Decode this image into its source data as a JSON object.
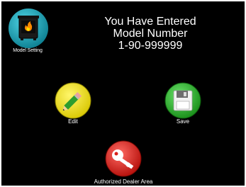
{
  "model_setting": {
    "label": "Model Setting",
    "icon": "stove-fire-icon"
  },
  "message": {
    "line1": "You Have Entered",
    "line2": "Model Number",
    "line3": "1-90-999999"
  },
  "buttons": {
    "edit": {
      "label": "Edit",
      "icon": "pencil-icon",
      "color": "#f4e400"
    },
    "save": {
      "label": "Save",
      "icon": "floppy-disk-icon",
      "color": "#2fb92f"
    },
    "dealer": {
      "label": "Authorized Dealer Area",
      "icon": "key-icon",
      "color": "#e0211c"
    }
  },
  "colors": {
    "background": "#000000",
    "accent_teal": "#19a4b6"
  }
}
